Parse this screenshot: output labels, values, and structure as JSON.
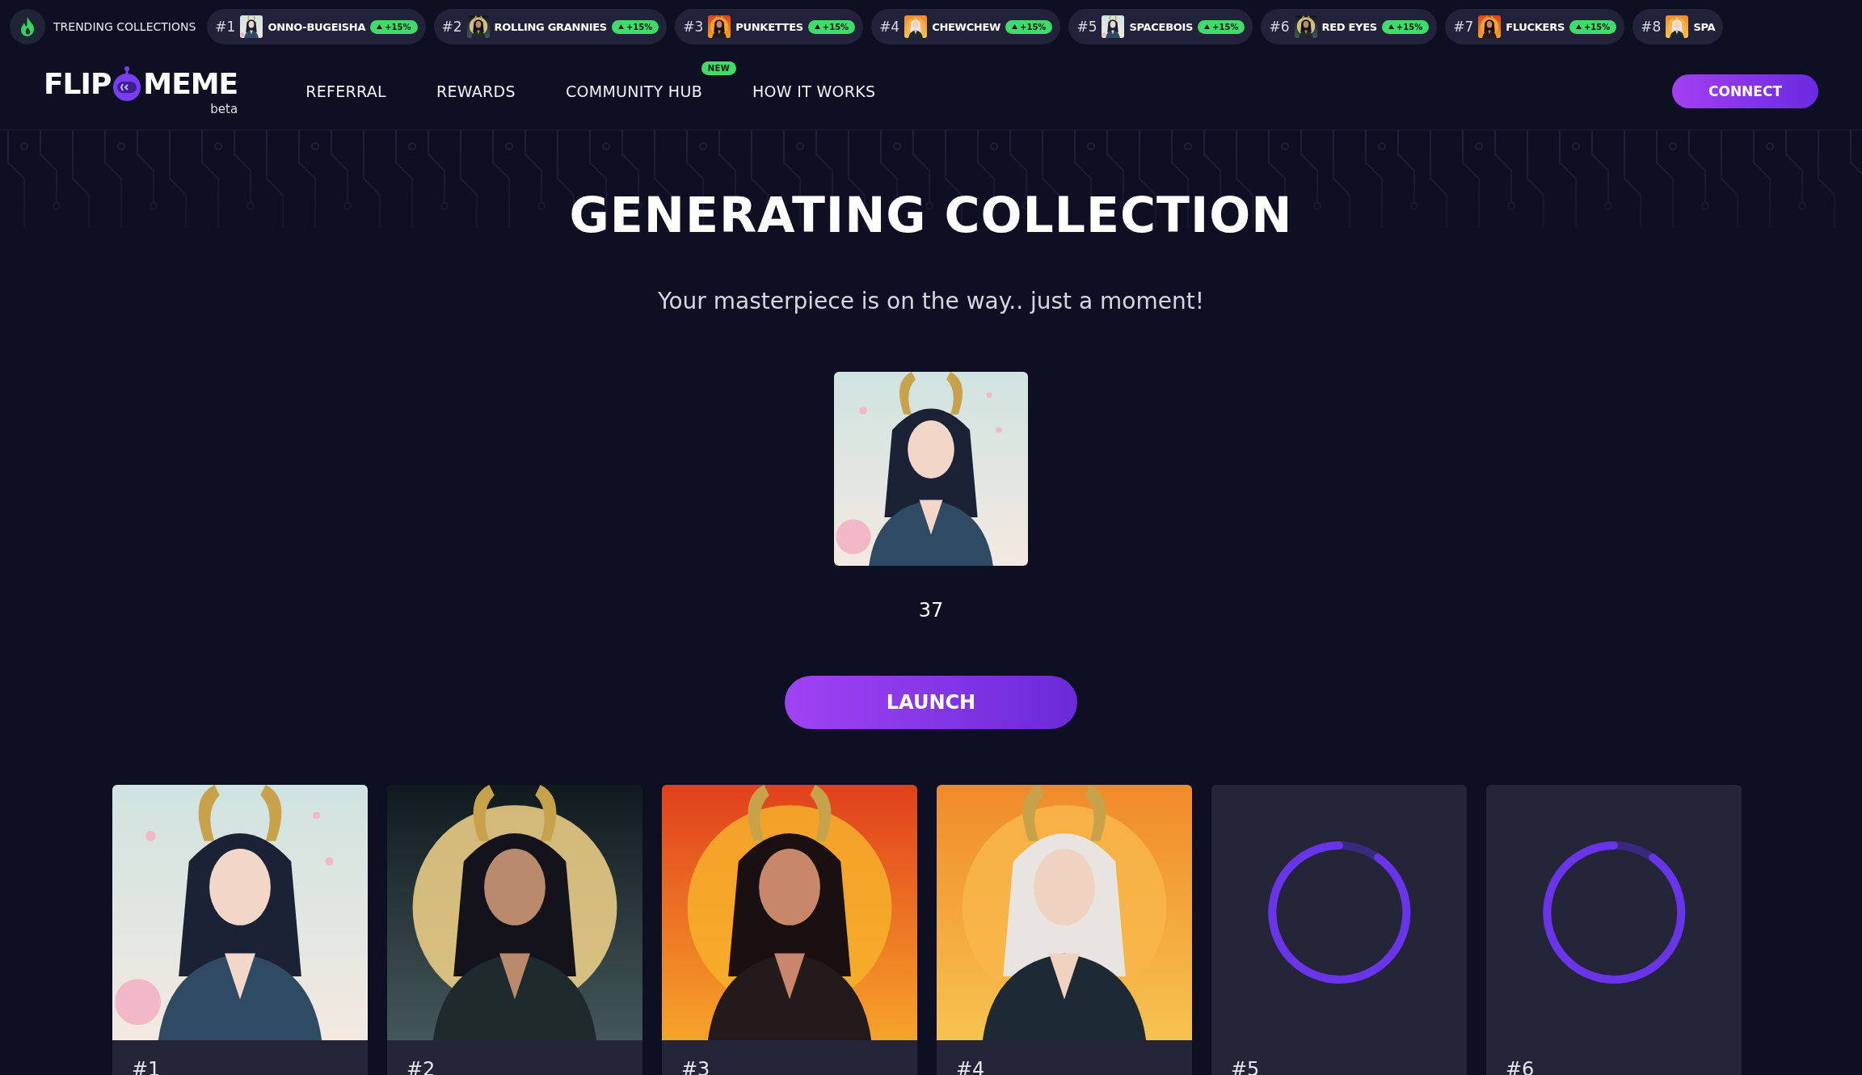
{
  "trending": {
    "label": "TRENDING COLLECTIONS",
    "items": [
      {
        "rank": "#1",
        "name": "ONNO-BUGEISHA",
        "change": "+15%"
      },
      {
        "rank": "#2",
        "name": "ROLLING GRANNIES",
        "change": "+15%"
      },
      {
        "rank": "#3",
        "name": "PUNKETTES",
        "change": "+15%"
      },
      {
        "rank": "#4",
        "name": "CHEWCHEW",
        "change": "+15%"
      },
      {
        "rank": "#5",
        "name": "SPACEBOIS",
        "change": "+15%"
      },
      {
        "rank": "#6",
        "name": "RED EYES",
        "change": "+15%"
      },
      {
        "rank": "#7",
        "name": "FLUCKERS",
        "change": "+15%"
      },
      {
        "rank": "#8",
        "name": "SPA"
      }
    ]
  },
  "nav": {
    "logo": {
      "text_1": "FLIP",
      "text_2": "MEME",
      "tag": "beta"
    },
    "links": [
      {
        "label": "REFERRAL"
      },
      {
        "label": "REWARDS"
      },
      {
        "label": "COMMUNITY HUB",
        "badge": "NEW"
      },
      {
        "label": "HOW IT WORKS"
      }
    ],
    "connect": "CONNECT"
  },
  "hero": {
    "title": "GENERATING COLLECTION",
    "subtitle": "Your masterpiece is on the way.. just a moment!",
    "counter": "37",
    "button": "LAUNCH"
  },
  "cards": [
    {
      "label": "#1",
      "kind": "picture"
    },
    {
      "label": "#2",
      "kind": "picture"
    },
    {
      "label": "#3",
      "kind": "picture"
    },
    {
      "label": "#4",
      "kind": "picture"
    },
    {
      "label": "#5",
      "kind": "loading"
    },
    {
      "label": "#6",
      "kind": "loading"
    }
  ]
}
